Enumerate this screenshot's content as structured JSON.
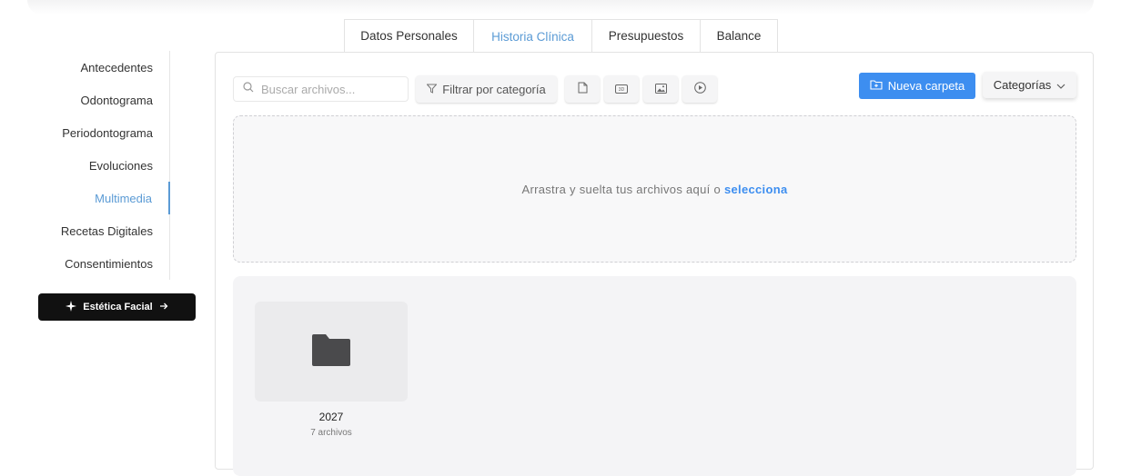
{
  "tabs": [
    {
      "label": "Datos Personales",
      "active": false
    },
    {
      "label": "Historia Clínica",
      "active": true
    },
    {
      "label": "Presupuestos",
      "active": false
    },
    {
      "label": "Balance",
      "active": false
    }
  ],
  "sidebar": {
    "items": [
      {
        "label": "Antecedentes"
      },
      {
        "label": "Odontograma"
      },
      {
        "label": "Periodontograma"
      },
      {
        "label": "Evoluciones"
      },
      {
        "label": "Multimedia",
        "active": true
      },
      {
        "label": "Recetas Digitales"
      },
      {
        "label": "Consentimientos"
      }
    ],
    "estetica_label": "Estética Facial"
  },
  "toolbar": {
    "search_placeholder": "Buscar archivos...",
    "filter_label": "Filtrar por categoría",
    "type_filters": [
      "document-icon",
      "3d-icon",
      "image-icon",
      "video-icon"
    ],
    "new_folder_label": "Nueva carpeta",
    "categories_label": "Categorías"
  },
  "dropzone": {
    "text": "Arrastra y suelta tus archivos aquí o",
    "link": "selecciona"
  },
  "folders": [
    {
      "name": "2027",
      "count": "7 archivos"
    }
  ],
  "colors": {
    "accent": "#5b9bd5",
    "primary_button": "#3d8ef0",
    "dark_button": "#111111"
  }
}
